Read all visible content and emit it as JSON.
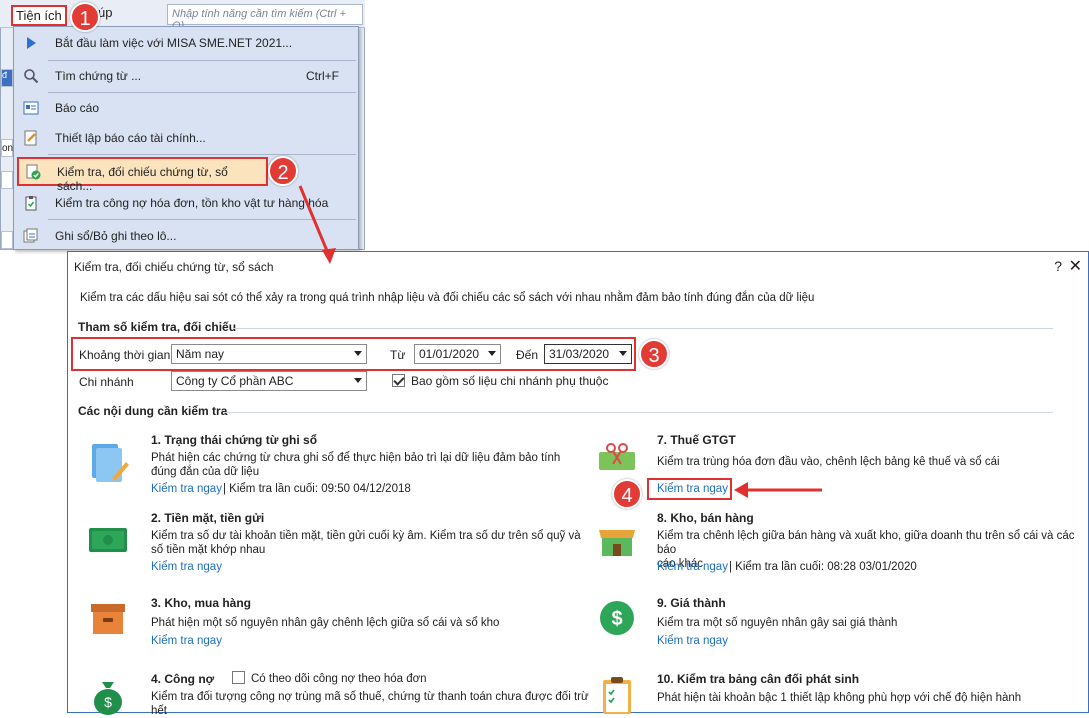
{
  "menubar": {
    "tab_tienich": "Tiện ích",
    "tab_tro_giup": "úp",
    "search_placeholder": "Nhập tính năng cần tìm kiếm (Ctrl + Q)"
  },
  "dropdown": {
    "items": [
      {
        "label": "Bắt đầu làm việc với MISA SME.NET 2021...",
        "shortcut": ""
      },
      {
        "label": "Tìm chứng từ ...",
        "shortcut": "Ctrl+F"
      },
      {
        "label": "Báo cáo",
        "shortcut": ""
      },
      {
        "label": "Thiết lập báo cáo tài chính...",
        "shortcut": ""
      },
      {
        "label": "Kiểm tra, đối chiếu chứng từ, sổ sách...",
        "shortcut": ""
      },
      {
        "label": "Kiểm tra công nợ hóa đơn, tồn kho vật tư hàng hóa",
        "shortcut": ""
      },
      {
        "label": "Ghi sổ/Bỏ ghi theo lô...",
        "shortcut": ""
      }
    ]
  },
  "left_strip": {
    "a": "đ",
    "b": "on"
  },
  "badges": [
    "1",
    "2",
    "3",
    "4"
  ],
  "dialog": {
    "title": "Kiểm tra, đối chiếu chứng từ, sổ sách",
    "help": "?",
    "close": "✕",
    "description": "Kiểm tra các dấu hiệu sai sót có thể xảy ra trong quá trình nhập liệu và đối chiếu các sổ sách với nhau nhằm đảm bảo tính đúng đắn của dữ liệu",
    "params_title": "Tham số kiểm tra, đối chiếu",
    "period_label": "Khoảng thời gian",
    "period_value": "Năm nay",
    "from_label": "Từ",
    "from_value": "01/01/2020",
    "to_label": "Đến",
    "to_value": "31/03/2020",
    "branch_label": "Chi nhánh",
    "branch_value": "Công ty Cổ phần ABC",
    "include_sub_label": "Bao gồm số liệu chi nhánh phụ thuộc",
    "include_sub_checked": true,
    "contents_title": "Các nội dung cần kiểm tra"
  },
  "cards": {
    "c1": {
      "title": "1. Trạng thái chứng từ ghi sổ",
      "desc1": "Phát hiện các chứng từ chưa ghi sổ để thực hiện bảo trì lại dữ liệu đảm bảo tính",
      "desc2": "đúng đắn của dữ liệu",
      "link": "Kiểm tra ngay",
      "last": "| Kiểm tra lần cuối: 09:50 04/12/2018"
    },
    "c2": {
      "title": "2. Tiền mặt, tiền gửi",
      "desc1": "Kiểm tra số dư tài khoản tiền mặt, tiền gửi cuối kỳ âm. Kiểm tra số dư trên sổ quỹ và",
      "desc2": "số tiền mặt khớp nhau",
      "link": "Kiểm tra ngay"
    },
    "c3": {
      "title": "3. Kho, mua hàng",
      "desc1": "Phát hiện một số nguyên nhân gây chênh lệch giữa sổ cái và sổ kho",
      "link": "Kiểm tra ngay"
    },
    "c4": {
      "title": "4. Công nợ",
      "check_label": "Có theo dõi công nợ theo hóa đơn",
      "desc1": "Kiểm tra đối tượng công nợ trùng mã số thuế, chứng từ thanh toán chưa được đối trừ",
      "desc2": "hết"
    },
    "c7": {
      "title": "7. Thuế GTGT",
      "desc1": "Kiểm tra trùng hóa đơn đầu vào, chênh lệch bảng kê thuế và sổ cái",
      "link": "Kiểm tra ngay"
    },
    "c8": {
      "title": "8. Kho, bán hàng",
      "desc1": "Kiểm tra chênh lệch giữa bán hàng và xuất kho, giữa doanh thu trên sổ cái và các báo",
      "desc2": "cáo khác",
      "link": "Kiểm tra ngay",
      "last": "| Kiểm tra lần cuối: 08:28 03/01/2020"
    },
    "c9": {
      "title": "9. Giá thành",
      "desc1": "Kiểm tra một số nguyên nhân gây sai giá thành",
      "link": "Kiểm tra ngay"
    },
    "c10": {
      "title": "10. Kiểm tra bảng cân đối phát sinh",
      "desc1": "Phát hiện tài khoản bậc 1 thiết lập không phù hợp với chế độ hiện hành"
    }
  },
  "colors": {
    "accent": "#e03030",
    "link": "#1f6fbf",
    "menu_bg": "#d8e2f3"
  }
}
